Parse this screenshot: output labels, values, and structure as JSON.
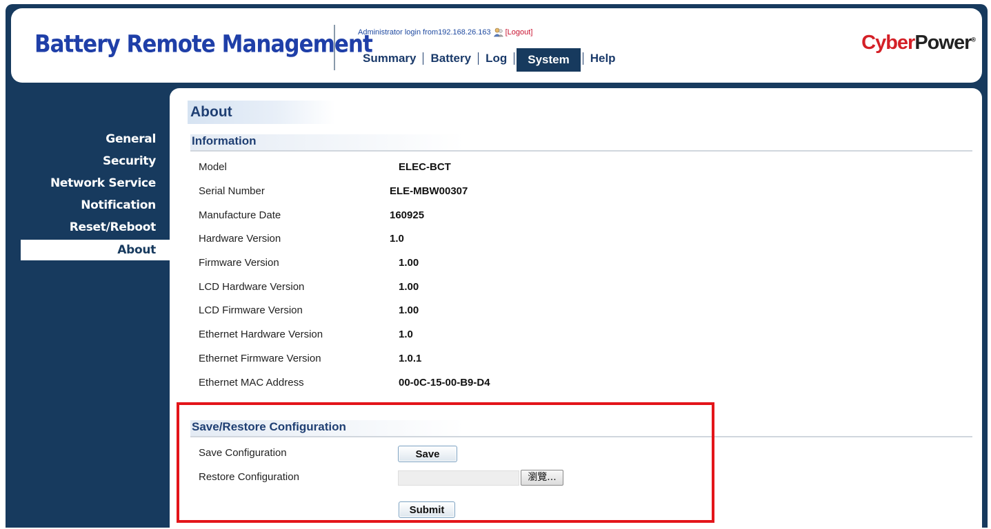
{
  "header": {
    "app_title": "Battery Remote Management",
    "login_text": "Administrator login from192.168.26.163",
    "logout_text": "[Logout]",
    "logo_part1": "Cyber",
    "logo_part2": "Power",
    "logo_mark": "®"
  },
  "nav": {
    "items": [
      {
        "label": "Summary"
      },
      {
        "label": "Battery"
      },
      {
        "label": "Log"
      },
      {
        "label": "System",
        "active": true
      },
      {
        "label": "Help"
      }
    ]
  },
  "sidebar": {
    "items": [
      {
        "label": "General"
      },
      {
        "label": "Security"
      },
      {
        "label": "Network Service"
      },
      {
        "label": "Notification"
      },
      {
        "label": "Reset/Reboot"
      },
      {
        "label": "About",
        "active": true
      }
    ]
  },
  "main": {
    "page_title": "About",
    "information": {
      "heading": "Information",
      "rows": [
        {
          "label": "Model",
          "value": "ELEC-BCT"
        },
        {
          "label": "Serial Number",
          "value": "ELE-MBW00307"
        },
        {
          "label": "Manufacture Date",
          "value": "160925"
        },
        {
          "label": "Hardware Version",
          "value": "1.0"
        },
        {
          "label": "Firmware Version",
          "value": "1.00"
        },
        {
          "label": "LCD Hardware Version",
          "value": "1.00"
        },
        {
          "label": "LCD Firmware Version",
          "value": "1.00"
        },
        {
          "label": "Ethernet Hardware Version",
          "value": "1.0"
        },
        {
          "label": "Ethernet Firmware Version",
          "value": "1.0.1"
        },
        {
          "label": "Ethernet MAC Address",
          "value": "00-0C-15-00-B9-D4"
        }
      ]
    },
    "config": {
      "heading": "Save/Restore Configuration",
      "save_label": "Save Configuration",
      "save_button": "Save",
      "restore_label": "Restore Configuration",
      "file_value": "",
      "browse_button": "瀏覽...",
      "submit_button": "Submit"
    }
  },
  "colors": {
    "frame": "#173a5e",
    "brand": "#1f3fa8",
    "highlight": "#e3151a",
    "logo_red": "#d42027"
  },
  "icons": {
    "user": "user-icon"
  }
}
